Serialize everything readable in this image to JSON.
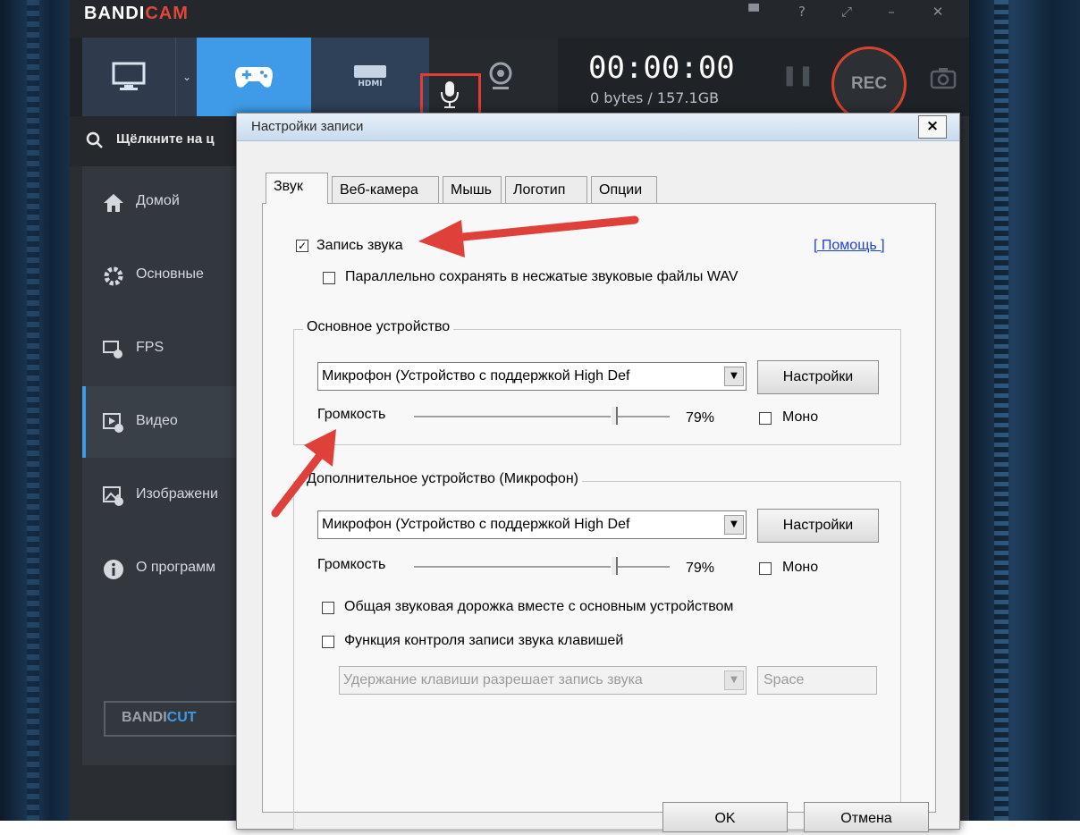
{
  "app": {
    "logo_main": "BANDI",
    "logo_accent": "CAM",
    "timer": "00:00:00",
    "bytes": "0 bytes / 157.1GB",
    "rec_label": "REC",
    "search_text": "Щёлкните на ц",
    "sidebar": [
      {
        "label": "Домой",
        "icon": "home-icon"
      },
      {
        "label": "Основные",
        "icon": "gear-icon"
      },
      {
        "label": "FPS",
        "icon": "fps-icon"
      },
      {
        "label": "Видео",
        "icon": "video-icon"
      },
      {
        "label": "Изображени",
        "icon": "image-icon"
      },
      {
        "label": "О программ",
        "icon": "info-icon"
      }
    ],
    "bandicut_main": "BANDI",
    "bandicut_accent": "CUT",
    "hdmi_label": "HDMI",
    "colors": {
      "accent": "#3f9be8",
      "rec": "#d8432f",
      "highlight": "#e33b35"
    }
  },
  "dialog": {
    "title": "Настройки записи",
    "close_label": "×",
    "tabs": [
      "Звук",
      "Веб-камера",
      "Мышь",
      "Логотип",
      "Опции"
    ],
    "record_sound_label": "Запись звука",
    "record_sound_checked": true,
    "help_link": "[ Помощь ]",
    "wav_label": "Параллельно сохранять в несжатые звуковые файлы WAV",
    "wav_checked": false,
    "primary": {
      "title": "Основное устройство",
      "device": "Микрофон (Устройство с поддержкой High Def",
      "settings_label": "Настройки",
      "volume_label": "Громкость",
      "volume_value": "79%",
      "volume_fraction": 0.79,
      "mono_label": "Моно",
      "mono_checked": false
    },
    "secondary": {
      "title": "Дополнительное устройство (Микрофон)",
      "device": "Микрофон (Устройство с поддержкой High Def",
      "settings_label": "Настройки",
      "volume_label": "Громкость",
      "volume_value": "79%",
      "volume_fraction": 0.79,
      "mono_label": "Моно",
      "mono_checked": false,
      "mix_label": "Общая звуковая дорожка вместе с основным устройством",
      "mix_checked": false,
      "hotkey_label": "Функция контроля записи звука клавишей",
      "hotkey_checked": false,
      "hotkey_mode": "Удержание клавиши разрешает запись звука",
      "hotkey_key": "Space"
    },
    "ok_label": "OK",
    "cancel_label": "Отмена"
  }
}
